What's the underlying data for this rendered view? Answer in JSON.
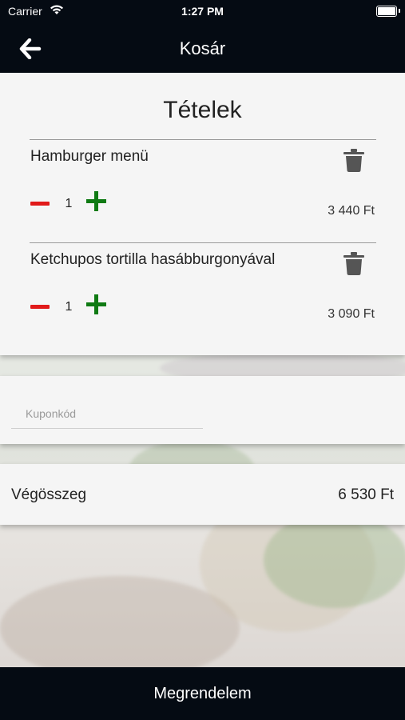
{
  "status_bar": {
    "carrier": "Carrier",
    "time": "1:27 PM"
  },
  "nav": {
    "title": "Kosár",
    "back_icon": "arrow-left-icon"
  },
  "cart": {
    "heading": "Tételek",
    "items": [
      {
        "name": "Hamburger menü",
        "quantity": "1",
        "price": "3 440 Ft"
      },
      {
        "name": "Ketchupos tortilla hasábburgonyával",
        "quantity": "1",
        "price": "3 090 Ft"
      }
    ]
  },
  "coupon": {
    "placeholder": "Kuponkód",
    "value": ""
  },
  "total": {
    "label": "Végösszeg",
    "value": "6 530 Ft"
  },
  "order_button": {
    "label": "Megrendelem"
  },
  "colors": {
    "dark": "#050b13",
    "minus": "#e11a1a",
    "plus": "#0f7a13",
    "card": "#f5f5f5"
  }
}
